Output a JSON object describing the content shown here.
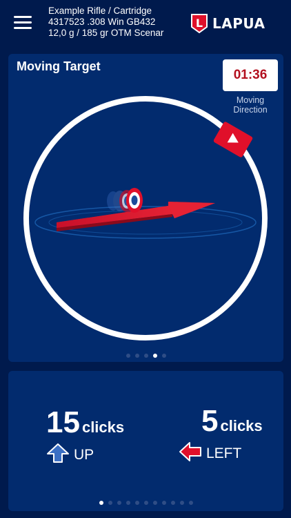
{
  "header": {
    "rifle_line1": "Example Rifle / Cartridge",
    "rifle_line2": "4317523 .308 Win GB432",
    "rifle_line3": "12,0 g / 185 gr  OTM Scenar",
    "logo_text": "LAPUA",
    "logo_letter": "L"
  },
  "target_panel": {
    "title": "Moving Target",
    "timer": "01:36",
    "moving_direction_label": "Moving\nDirection",
    "moving_direction_line1": "Moving",
    "moving_direction_line2": "Direction",
    "page_count": 5,
    "active_page": 3
  },
  "clicks_panel": {
    "vertical": {
      "value": "15",
      "unit": "clicks",
      "direction": "UP"
    },
    "horizontal": {
      "value": "5",
      "unit": "clicks",
      "direction": "LEFT"
    },
    "page_count": 11,
    "active_page": 0
  },
  "colors": {
    "background": "#001a4d",
    "panel": "#022b6e",
    "accent_red": "#e0102a",
    "arrow_blue": "#3b6fc4",
    "timer_text": "#b3101f"
  },
  "icons": {
    "menu": "hamburger-icon",
    "up_arrow": "arrow-up-icon",
    "left_arrow": "arrow-left-icon",
    "play": "play-icon"
  }
}
